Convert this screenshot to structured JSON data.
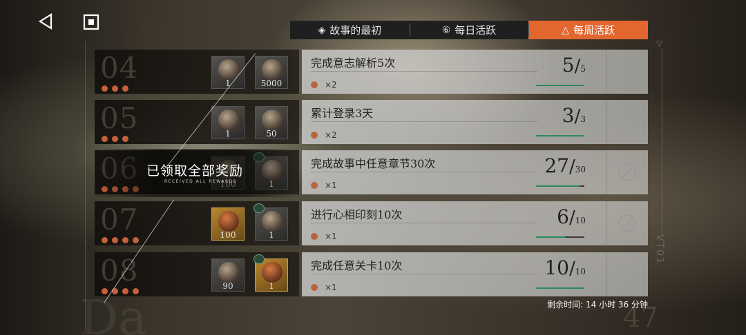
{
  "tabs": [
    {
      "label": "故事的最初",
      "icon": "diamond-icon",
      "active": false
    },
    {
      "label": "每日活跃",
      "icon": "circle-six-icon",
      "active": false
    },
    {
      "label": "每周活跃",
      "icon": "triangle-icon",
      "active": true
    }
  ],
  "rows": [
    {
      "num": "04",
      "dots": 3,
      "items": [
        {
          "qty": "1",
          "icon": "helmet-icon",
          "gold": false,
          "badge": false
        },
        {
          "qty": "5000",
          "icon": "coin-bundle-icon",
          "gold": false,
          "badge": false
        }
      ],
      "title": "完成意志解析5次",
      "mult": "×2",
      "cur": "5",
      "tot": "5",
      "progress": 1.0
    },
    {
      "num": "05",
      "dots": 3,
      "items": [
        {
          "qty": "1",
          "icon": "helmet-icon",
          "gold": false,
          "badge": false
        },
        {
          "qty": "50",
          "icon": "crystal-icon",
          "gold": false,
          "badge": false
        }
      ],
      "title": "累计登录3天",
      "mult": "×2",
      "cur": "3",
      "tot": "3",
      "progress": 1.0
    },
    {
      "num": "06",
      "dots": 4,
      "items": [
        {
          "qty": "100",
          "icon": "gem-icon",
          "gold": false,
          "badge": false
        },
        {
          "qty": "1",
          "icon": "candy-icon",
          "gold": false,
          "badge": true
        }
      ],
      "title": "完成故事中任意章节30次",
      "mult": "×1",
      "cur": "27",
      "tot": "30",
      "progress": 0.9
    },
    {
      "num": "07",
      "dots": 4,
      "items": [
        {
          "qty": "100",
          "icon": "gem-icon",
          "gold": true,
          "badge": false
        },
        {
          "qty": "1",
          "icon": "candy-icon",
          "gold": false,
          "badge": true
        }
      ],
      "title": "进行心相印刻10次",
      "mult": "×1",
      "cur": "6",
      "tot": "10",
      "progress": 0.6
    },
    {
      "num": "08",
      "dots": 4,
      "items": [
        {
          "qty": "90",
          "icon": "card-icon",
          "gold": false,
          "badge": false
        },
        {
          "qty": "1",
          "icon": "key-icon",
          "gold": true,
          "badge": true
        }
      ],
      "title": "完成任意关卡10次",
      "mult": "×1",
      "cur": "10",
      "tot": "10",
      "progress": 1.0
    }
  ],
  "received": {
    "cn": "已领取全部奖励",
    "en": "RECEIVED ALL REWARDS"
  },
  "remaining": "剩余时间: 14 小时 36 分钟",
  "deco": {
    "da": "Da",
    "num": "47",
    "vt": "VT01"
  },
  "colors": {
    "accent": "#e2672f",
    "dot": "#c7613a",
    "progress": "#2b8a5d"
  }
}
